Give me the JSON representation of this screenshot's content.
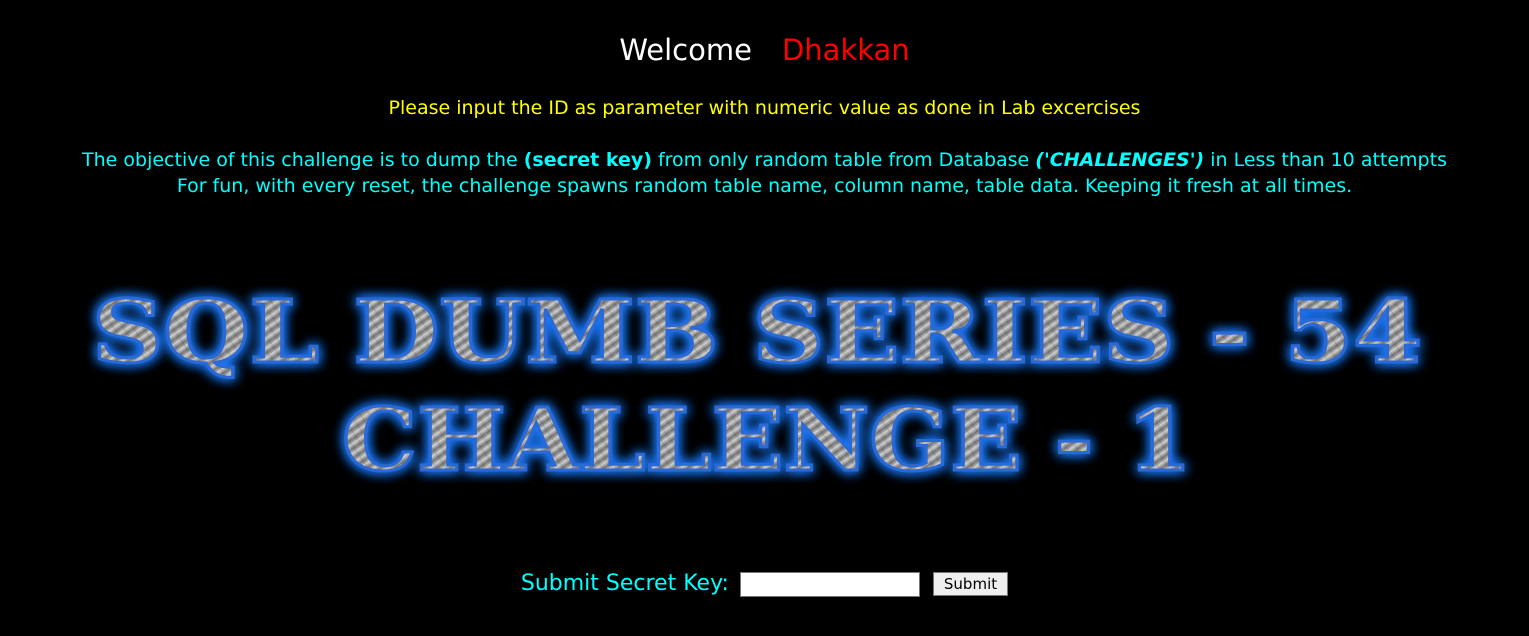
{
  "welcome": {
    "greeting": "Welcome",
    "username": "Dhakkan"
  },
  "instruction": "Please input the ID as parameter with numeric value as done in Lab excercises",
  "objective": {
    "line1_prefix": "The objective of this challenge is to dump the ",
    "line1_bold": "(secret key)",
    "line1_middle": " from only random table from Database ",
    "line1_db": "('CHALLENGES')",
    "line1_suffix": " in Less than 10 attempts",
    "line2": "For fun, with every reset, the challenge spawns random table name, column name, table data. Keeping it fresh at all times."
  },
  "banner": {
    "line1": "SQL DUMB SERIES - 54",
    "line2": "CHALLENGE - 1"
  },
  "form": {
    "label": "Submit Secret Key:",
    "input_value": "",
    "submit_label": "Submit"
  },
  "colors": {
    "background": "#000000",
    "welcome": "#ffffff",
    "username": "#ff0000",
    "instruction": "#ffff00",
    "objective": "#00ffff",
    "banner_glow": "#1e7bff",
    "banner_metal": "#9a9a9a"
  }
}
